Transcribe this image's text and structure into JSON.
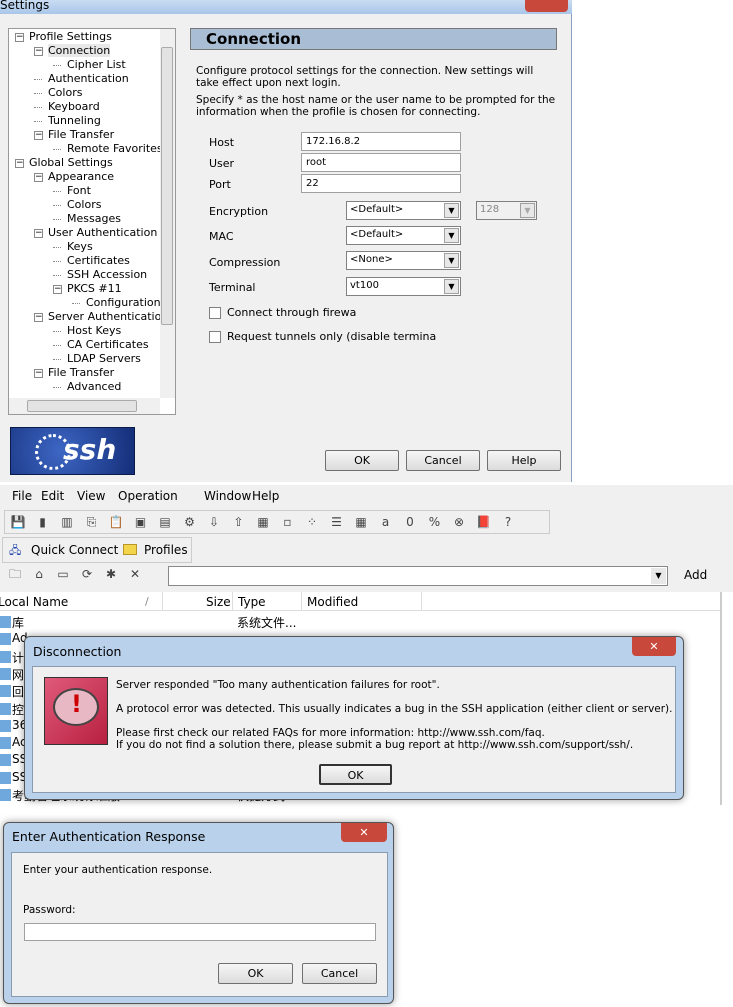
{
  "settings": {
    "title": "Settings",
    "tree": [
      {
        "label": "Profile Settings",
        "level": 0,
        "expander": true
      },
      {
        "label": "Connection",
        "level": 1,
        "expander": true,
        "selected": true
      },
      {
        "label": "Cipher List",
        "level": 2
      },
      {
        "label": "Authentication",
        "level": 1
      },
      {
        "label": "Colors",
        "level": 1
      },
      {
        "label": "Keyboard",
        "level": 1
      },
      {
        "label": "Tunneling",
        "level": 1
      },
      {
        "label": "File Transfer",
        "level": 1,
        "expander": true
      },
      {
        "label": "Remote Favorites",
        "level": 2
      },
      {
        "label": "Global Settings",
        "level": 0,
        "expander": true
      },
      {
        "label": "Appearance",
        "level": 1,
        "expander": true
      },
      {
        "label": "Font",
        "level": 2
      },
      {
        "label": "Colors",
        "level": 2
      },
      {
        "label": "Messages",
        "level": 2
      },
      {
        "label": "User Authentication",
        "level": 1,
        "expander": true
      },
      {
        "label": "Keys",
        "level": 2
      },
      {
        "label": "Certificates",
        "level": 2
      },
      {
        "label": "SSH Accession",
        "level": 2
      },
      {
        "label": "PKCS #11",
        "level": 2,
        "expander": true
      },
      {
        "label": "Configuration",
        "level": 3
      },
      {
        "label": "Server Authentication",
        "level": 1,
        "expander": true
      },
      {
        "label": "Host Keys",
        "level": 2
      },
      {
        "label": "CA Certificates",
        "level": 2
      },
      {
        "label": "LDAP Servers",
        "level": 2
      },
      {
        "label": "File Transfer",
        "level": 1,
        "expander": true
      },
      {
        "label": "Advanced",
        "level": 2
      }
    ],
    "panel_title": "Connection",
    "desc1": "Configure protocol settings for the connection. New settings will take effect upon next login.",
    "desc2": "Specify * as the host name or the user name to be prompted for the information when the profile is chosen for connecting.",
    "host_label": "Host",
    "host_value": "172.16.8.2",
    "user_label": "User",
    "user_value": "root",
    "port_label": "Port",
    "port_value": "22",
    "encryption_label": "Encryption",
    "encryption_value": "<Default>",
    "keysize_value": "128",
    "mac_label": "MAC",
    "mac_value": "<Default>",
    "compression_label": "Compression",
    "compression_value": "<None>",
    "terminal_label": "Terminal",
    "terminal_value": "vt100",
    "firewall_label": "Connect through firewa",
    "tunnels_label": "Request tunnels only (disable termina",
    "logo": "ssh",
    "ok": "OK",
    "cancel": "Cancel",
    "help": "Help"
  },
  "main": {
    "menu": [
      "File",
      "Edit",
      "View",
      "Operation",
      "Window",
      "Help"
    ],
    "quick_connect": "Quick Connect",
    "profiles": "Profiles",
    "add": "Add",
    "columns": [
      "Local Name",
      "Size",
      "Type",
      "Modified"
    ],
    "files": [
      {
        "name": "库",
        "size": "",
        "type": "系统文件...",
        "modified": ""
      },
      {
        "name": "Ad",
        "size": "",
        "type": "",
        "modified": ""
      },
      {
        "name": "计",
        "size": "",
        "type": "",
        "modified": ""
      },
      {
        "name": "网",
        "size": "",
        "type": "",
        "modified": ""
      },
      {
        "name": "回",
        "size": "",
        "type": "",
        "modified": ""
      },
      {
        "name": "控",
        "size": "",
        "type": "",
        "modified": ""
      },
      {
        "name": "36",
        "size": "",
        "type": "",
        "modified": ""
      },
      {
        "name": "Ac",
        "size": "",
        "type": "",
        "modified": ""
      },
      {
        "name": "SS",
        "size": "",
        "type": "",
        "modified": ""
      },
      {
        "name": "SS",
        "size": "",
        "type": "",
        "modified": ""
      },
      {
        "name": "考勤管理系统标准版",
        "size": "1 771",
        "type": "快捷方式",
        "modified": "2012/11/21 16:5"
      }
    ]
  },
  "disconnection": {
    "title": "Disconnection",
    "line1": "Server responded \"Too many authentication failures for root\".",
    "line2": "A protocol error was detected.  This usually indicates a bug in the SSH application (either client or server).",
    "line3": "Please first check our related FAQs for more information: http://www.ssh.com/faq.",
    "line4": "If you do not find a solution there, please submit a bug report at http://www.ssh.com/support/ssh/.",
    "ok": "OK"
  },
  "auth": {
    "title": "Enter Authentication Response",
    "prompt": "Enter your authentication response.",
    "password_label": "Password:",
    "password_value": "",
    "ok": "OK",
    "cancel": "Cancel"
  },
  "colors": {
    "header_bg": "#a9bdd5",
    "logo_bg": "#1a3c8c",
    "close_red": "#c9483c"
  }
}
